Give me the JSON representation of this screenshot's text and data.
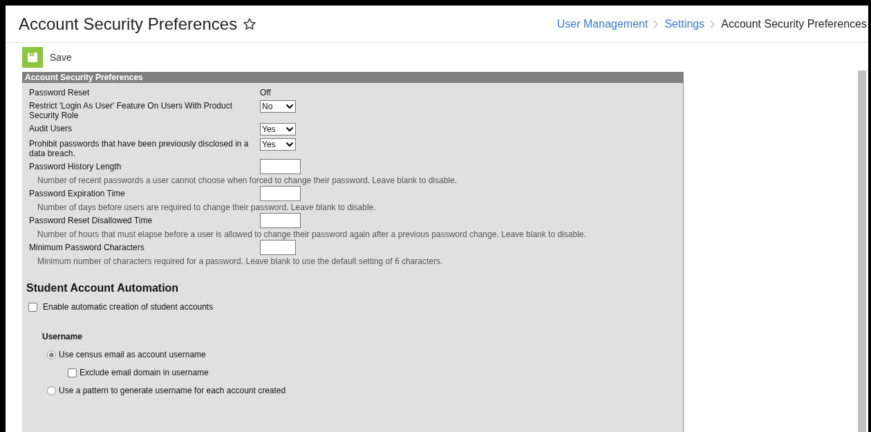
{
  "page": {
    "title": "Account Security Preferences",
    "favorite": false
  },
  "breadcrumb": [
    {
      "label": "User Management",
      "kind": "link"
    },
    {
      "label": "Settings",
      "kind": "link"
    },
    {
      "label": "Account Security Preferences",
      "kind": "current"
    }
  ],
  "toolbar": {
    "save": "Save"
  },
  "panel": {
    "title": "Account Security Preferences",
    "fields": [
      {
        "kind": "text",
        "label": "Password Reset",
        "value": "Off"
      },
      {
        "kind": "select",
        "label": "Restrict 'Login As User' Feature On Users With Product Security Role",
        "value": "No"
      },
      {
        "kind": "select",
        "label": "Audit Users",
        "value": "Yes"
      },
      {
        "kind": "select",
        "label": "Prohibit passwords that have been previously disclosed in a data breach.",
        "value": "Yes"
      },
      {
        "kind": "input",
        "label": "Password History Length",
        "hint": "Number of recent passwords a user cannot choose when forced to change their password. Leave blank to disable."
      },
      {
        "kind": "input",
        "label": "Password Expiration Time",
        "hint": "Number of days before users are required to change their password. Leave blank to disable."
      },
      {
        "kind": "input",
        "label": "Password Reset Disallowed Time",
        "hint": "Number of hours that must elapse before a user is allowed to change their password again after a previous password change. Leave blank to disable."
      },
      {
        "kind": "input",
        "label": "Minimum Password Characters",
        "hint": "Minimum number of characters required for a password. Leave blank to use the default setting of 6 characters."
      }
    ],
    "automation": {
      "title": "Student Account Automation",
      "enable": {
        "label": "Enable automatic creation of student accounts",
        "checked": false
      },
      "username": {
        "title": "Username",
        "options": [
          {
            "label": "Use census email as account username",
            "selected": true,
            "sub": {
              "label": "Exclude email domain in username",
              "checked": false
            }
          },
          {
            "label": "Use a pattern to generate username for each account created",
            "selected": false
          }
        ]
      }
    }
  }
}
